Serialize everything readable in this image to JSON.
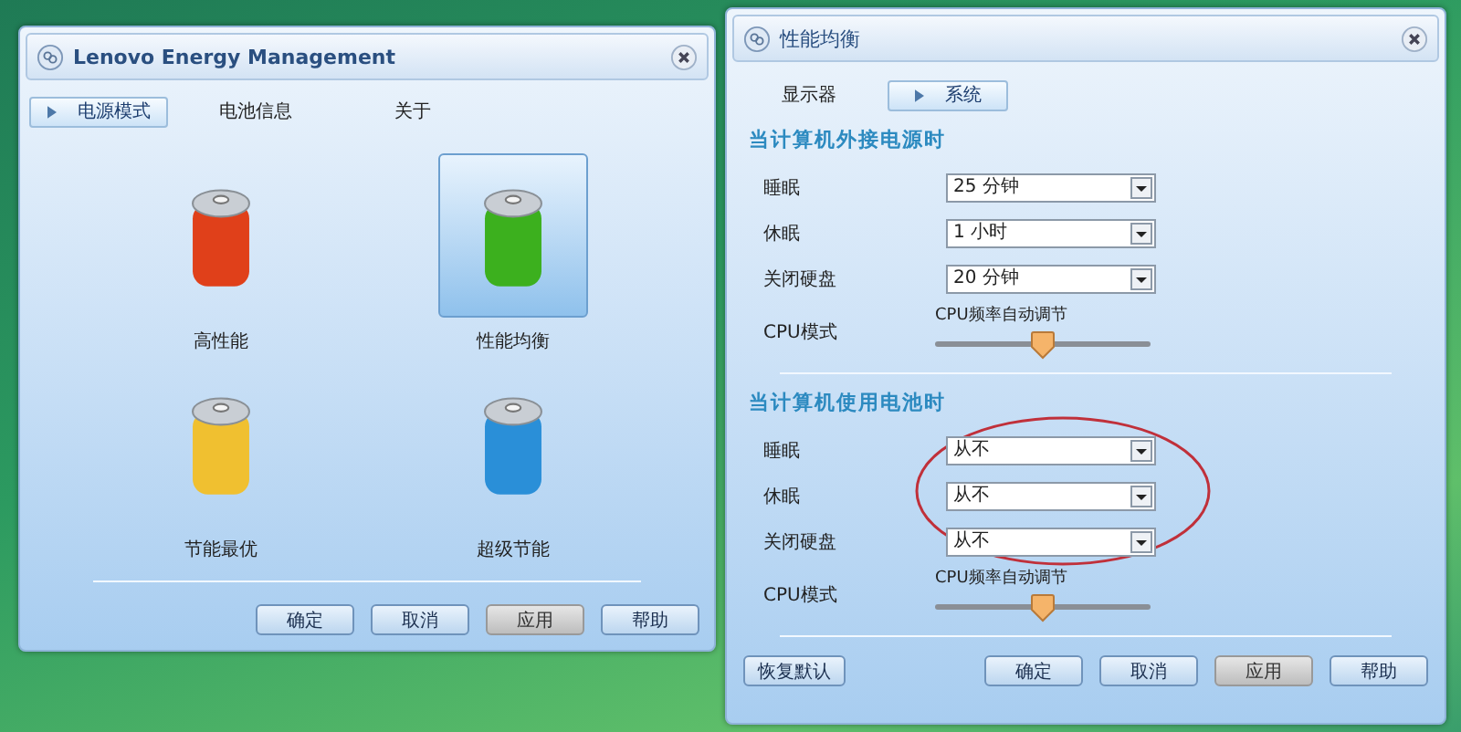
{
  "energy_window": {
    "title": "Lenovo Energy Management",
    "tabs": [
      {
        "label": "电源模式",
        "selected": true
      },
      {
        "label": "电池信息",
        "selected": false
      },
      {
        "label": "关于",
        "selected": false
      }
    ],
    "modes": [
      {
        "label": "高性能",
        "selected": false,
        "color": "#e0401a"
      },
      {
        "label": "性能均衡",
        "selected": true,
        "color": "#3cb01e"
      },
      {
        "label": "节能最优",
        "selected": false,
        "color": "#f0c030"
      },
      {
        "label": "超级节能",
        "selected": false,
        "color": "#2a8fd8"
      }
    ],
    "buttons": [
      {
        "label": "确定",
        "disabled": false
      },
      {
        "label": "取消",
        "disabled": false
      },
      {
        "label": "应用",
        "disabled": true
      },
      {
        "label": "帮助",
        "disabled": false
      }
    ]
  },
  "settings_window": {
    "title": "性能均衡",
    "tabs": [
      {
        "label": "显示器",
        "selected": false
      },
      {
        "label": "系统",
        "selected": true
      }
    ],
    "sections": [
      {
        "heading": "当计算机外接电源时",
        "rows": [
          {
            "label": "睡眠",
            "value": "25 分钟"
          },
          {
            "label": "休眠",
            "value": "1 小时"
          },
          {
            "label": "关闭硬盘",
            "value": "20 分钟"
          }
        ],
        "cpu_label": "CPU模式",
        "cpu_caption": "CPU频率自动调节",
        "level": 0.5
      },
      {
        "heading": "当计算机使用电池时",
        "rows": [
          {
            "label": "睡眠",
            "value": "从不"
          },
          {
            "label": "休眠",
            "value": "从不"
          },
          {
            "label": "关闭硬盘",
            "value": "从不"
          }
        ],
        "cpu_label": "CPU模式",
        "cpu_caption": "CPU频率自动调节",
        "level": 0.5
      }
    ],
    "reset_button": "恢复默认",
    "buttons": [
      {
        "label": "确定",
        "disabled": false
      },
      {
        "label": "取消",
        "disabled": false
      },
      {
        "label": "应用",
        "disabled": true
      },
      {
        "label": "帮助",
        "disabled": false
      }
    ]
  }
}
